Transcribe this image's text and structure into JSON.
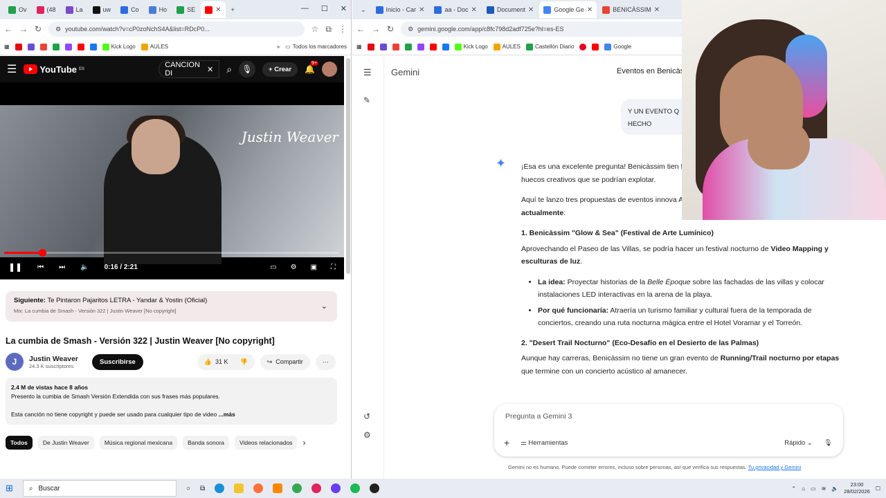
{
  "left_browser": {
    "tabs": [
      {
        "label": "Ov",
        "color": "#1fa14a"
      },
      {
        "label": "(48",
        "color": "#e0245e"
      },
      {
        "label": "La",
        "color": "#7b4bc8"
      },
      {
        "label": "uw",
        "color": "#111111"
      },
      {
        "label": "Co",
        "color": "#2d6cdf"
      },
      {
        "label": "Ho",
        "color": "#4a7bd8"
      },
      {
        "label": "SE",
        "color": "#1fa14a"
      },
      {
        "label": "",
        "color": "#ff0000"
      }
    ],
    "url": "youtube.com/watch?v=cP0zoNchS4A&list=RDcP0...",
    "bookmarks": [
      "Kick Logo",
      "AULES"
    ],
    "bookmarks_right": "Todos los marcadores"
  },
  "youtube": {
    "logo": "YouTube",
    "logo_region": "ES",
    "search_value": "CANCION DI",
    "create_label": "Crear",
    "notif_badge": "9+",
    "watermark": "Justin Weaver",
    "time": "0:16 / 2:21",
    "progress": 0.113,
    "next_label": "Siguiente:",
    "next_title": "Te Pintaron Pajaritos LETRA - Yandar & Yostin (Oficial)",
    "next_mix": "Mix: La cumbia de Smash - Versión 322 | Justin Weaver [No copyright]",
    "title": "La cumbia de Smash - Versión 322 | Justin Weaver [No copyright]",
    "channel_initial": "J",
    "channel": "Justin Weaver",
    "subscribers": "24.3 K suscriptores",
    "subscribe": "Suscribirse",
    "likes": "31 K",
    "share": "Compartir",
    "views": "2.4 M de vistas  hace 8 años",
    "desc1": "Presento la cumbia de Smash Versión Extendida con sus frases más populares.",
    "desc2": "Esta canción no tiene copyright y puede ser usado para cualquier tipo de video",
    "more": "...más",
    "chips": [
      "Todos",
      "De Justin Weaver",
      "Música regional mexicana",
      "Banda sonora",
      "Videos relacionados"
    ]
  },
  "right_browser": {
    "tabs": [
      {
        "label": "Inicio - Car",
        "color": "#2d6cdf"
      },
      {
        "label": "aa - Doc",
        "color": "#2d6cdf"
      },
      {
        "label": "Document",
        "color": "#1e5bb8"
      },
      {
        "label": "Google Ge",
        "color": "#4285f4"
      },
      {
        "label": "BENICÀSSIM",
        "color": "#ea4335"
      }
    ],
    "url": "gemini.google.com/app/c8fc798d2adf725e?hl=es-ES",
    "bookmarks": [
      "Kick Logo",
      "AULES",
      "Castellón Diario",
      "Google"
    ]
  },
  "gemini": {
    "brand": "Gemini",
    "conversation_title": "Eventos en Benicàs",
    "user_message": "Y UN EVENTO Q HECHO",
    "intro": "¡Esa es una excelente pregunta! Benicàssim tien festivales, las villas modernistas, el Desierto de l huecos creativos que se podrían explotar.",
    "intro2_a": "Aquí te lanzo tres propuestas de eventos innova ADN de la ciudad pero que ",
    "intro2_b": "no existen actualmente",
    "intro2_c": ":",
    "h1": "1. Benicàssim \"Glow & Sea\" (Festival de Arte Lumínico)",
    "p1_a": "Aprovechando el Paseo de las Villas, se podría hacer un festival nocturno de ",
    "p1_b": "Video Mapping y esculturas de luz",
    "p1_c": ".",
    "li1_label": "La idea:",
    "li1_a": " Proyectar historias de la ",
    "li1_em": "Belle Époque",
    "li1_b": " sobre las fachadas de las villas y colocar instalaciones LED interactivas en la arena de la playa.",
    "li2_label": "Por qué funcionaría:",
    "li2_text": " Atraería un turismo familiar y cultural fuera de la temporada de conciertos, creando una ruta nocturna mágica entre el Hotel Voramar y el Torreón.",
    "h2": "2. \"Desert Trail Nocturno\" (Eco-Desafío en el Desierto de las Palmas)",
    "p2_a": "Aunque hay carreras, Benicàssim no tiene un gran evento de ",
    "p2_b": "Running/Trail nocturno por etapas",
    "p2_c": " que termine con un concierto acústico al amanecer.",
    "input_placeholder": "Pregunta a Gemini 3",
    "tools": "Herramientas",
    "mode": "Rápido",
    "footer": "Gemini no es humano. Puede cometer errores, incluso sobre personas, así que verifica sus respuestas.",
    "footer_link": "Tu privacidad y Gemini"
  },
  "taskbar": {
    "search": "Buscar",
    "time": "23:00",
    "date": "28/02/2026"
  }
}
